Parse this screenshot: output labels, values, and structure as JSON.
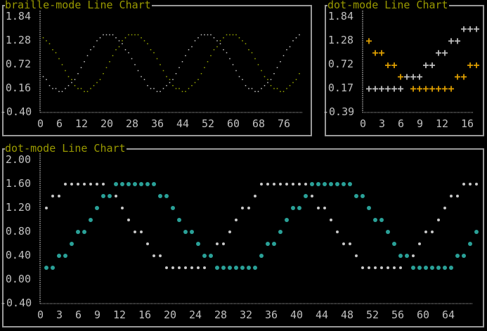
{
  "colors": {
    "title": "#9a9a00",
    "text": "#c0c0c0",
    "border": "#9a9a9a",
    "gray_series": "#c8c8c8",
    "green_series": "#9aaa00",
    "orange_series": "#e0a000",
    "teal_series": "#2aa198"
  },
  "chart_data": [
    {
      "type": "line",
      "title": "braille-mode Line Chart",
      "marker": "braille",
      "ylim": [
        -0.4,
        1.84
      ],
      "xlim": [
        0,
        82
      ],
      "yticks": [
        "1.84",
        "1.28",
        "0.72",
        "0.16",
        "-0.40"
      ],
      "xticks": [
        0,
        6,
        12,
        20,
        28,
        36,
        44,
        52,
        60,
        68,
        76
      ],
      "series": [
        {
          "name": "series-1",
          "color": "#c8c8c8",
          "x_start": 1,
          "values": [
            0.46,
            0.34,
            0.25,
            0.18,
            0.13,
            0.11,
            0.12,
            0.15,
            0.21,
            0.29,
            0.4,
            0.52,
            0.65,
            0.78,
            0.91,
            1.04,
            1.16,
            1.27,
            1.35,
            1.41,
            1.44,
            1.45,
            1.43,
            1.38,
            1.31,
            1.22,
            1.1,
            0.98,
            0.85,
            0.71,
            0.58,
            0.46,
            0.34,
            0.25,
            0.18,
            0.13,
            0.11,
            0.12,
            0.15,
            0.21,
            0.29,
            0.4,
            0.52,
            0.65,
            0.78,
            0.91,
            1.04,
            1.16,
            1.27,
            1.35,
            1.41,
            1.44,
            1.45,
            1.43,
            1.38,
            1.31,
            1.22,
            1.1,
            0.98,
            0.85,
            0.71,
            0.58,
            0.46,
            0.34,
            0.25,
            0.18,
            0.13,
            0.11,
            0.12,
            0.15,
            0.21,
            0.29,
            0.4,
            0.52,
            0.65,
            0.78,
            0.91,
            1.04,
            1.16,
            1.27,
            1.35,
            1.41
          ]
        },
        {
          "name": "series-2",
          "color": "#9aaa00",
          "x_start": 1,
          "values": [
            1.38,
            1.31,
            1.22,
            1.1,
            0.98,
            0.85,
            0.71,
            0.58,
            0.46,
            0.34,
            0.25,
            0.18,
            0.13,
            0.11,
            0.12,
            0.15,
            0.21,
            0.29,
            0.4,
            0.52,
            0.65,
            0.78,
            0.91,
            1.04,
            1.16,
            1.27,
            1.35,
            1.41,
            1.44,
            1.45,
            1.43,
            1.38,
            1.31,
            1.22,
            1.1,
            0.98,
            0.85,
            0.71,
            0.58,
            0.46,
            0.34,
            0.25,
            0.18,
            0.13,
            0.11,
            0.12,
            0.15,
            0.21,
            0.29,
            0.4,
            0.52,
            0.65,
            0.78,
            0.91,
            1.04,
            1.16,
            1.27,
            1.35,
            1.41,
            1.44,
            1.45,
            1.43,
            1.38,
            1.31,
            1.22,
            1.1,
            0.98,
            0.85,
            0.71,
            0.58,
            0.46,
            0.34,
            0.25,
            0.18,
            0.13,
            0.11,
            0.12,
            0.15,
            0.21,
            0.29,
            0.4,
            0.52
          ]
        }
      ]
    },
    {
      "type": "line",
      "title": "dot-mode Line Chart",
      "marker": "+",
      "ylim": [
        -0.39,
        1.84
      ],
      "xlim": [
        0,
        18
      ],
      "yticks": [
        "1.84",
        "1.28",
        "0.72",
        "0.17",
        "-0.39"
      ],
      "xticks": [
        0,
        3,
        6,
        9,
        12,
        16
      ],
      "series": [
        {
          "name": "series-1",
          "color": "#c0c0c0",
          "x_start": 1,
          "values": [
            0.17,
            0.17,
            0.17,
            0.17,
            0.17,
            0.17,
            0.45,
            0.45,
            0.45,
            0.72,
            0.72,
            1.0,
            1.0,
            1.28,
            1.28,
            1.56,
            1.56,
            1.56
          ]
        },
        {
          "name": "series-2",
          "color": "#e0a000",
          "x_start": 1,
          "values": [
            1.28,
            1.0,
            1.0,
            0.72,
            0.72,
            0.45,
            null,
            0.17,
            0.17,
            0.17,
            0.17,
            0.17,
            0.17,
            0.17,
            0.45,
            0.45,
            0.72,
            0.72
          ]
        }
      ]
    },
    {
      "type": "scatter",
      "title": "dot-mode Line Chart",
      "marker": "dot",
      "ylim": [
        -0.4,
        2.0
      ],
      "xlim": [
        0,
        69
      ],
      "yticks": [
        "2.00",
        "1.60",
        "1.20",
        "0.80",
        "0.40",
        "0.00",
        "-0.40"
      ],
      "xticks": [
        0,
        3,
        6,
        9,
        12,
        16,
        20,
        24,
        28,
        32,
        36,
        40,
        44,
        48,
        52,
        56,
        60,
        64
      ],
      "series": [
        {
          "name": "series-1",
          "color": "#c8c8c8",
          "x_start": 1,
          "values": [
            1.2,
            1.4,
            1.4,
            1.6,
            1.6,
            1.6,
            1.6,
            1.6,
            1.6,
            1.6,
            1.4,
            1.4,
            1.2,
            1.0,
            0.8,
            0.8,
            0.6,
            0.4,
            0.4,
            0.2,
            0.2,
            0.2,
            0.2,
            0.2,
            0.2,
            0.2,
            0.4,
            0.6,
            0.6,
            0.8,
            1.0,
            1.2,
            1.2,
            1.4,
            1.6,
            1.6,
            1.6,
            1.6,
            1.6,
            1.6,
            1.6,
            1.6,
            1.4,
            1.2,
            1.2,
            1.0,
            0.8,
            0.6,
            0.6,
            0.4,
            0.2,
            0.2,
            0.2,
            0.2,
            0.2,
            0.2,
            0.2,
            0.4,
            0.4,
            0.6,
            0.8,
            0.8,
            1.0,
            1.2,
            1.4,
            1.4,
            1.6,
            1.6,
            1.6
          ]
        },
        {
          "name": "series-2",
          "color": "#2aa198",
          "x_start": 1,
          "values": [
            0.2,
            0.2,
            0.4,
            0.4,
            0.6,
            0.8,
            0.8,
            1.0,
            1.2,
            1.4,
            1.4,
            1.6,
            1.6,
            1.6,
            1.6,
            1.6,
            1.6,
            1.6,
            1.4,
            1.4,
            1.2,
            1.0,
            0.8,
            0.8,
            0.6,
            0.4,
            0.4,
            0.2,
            0.2,
            0.2,
            0.2,
            0.2,
            0.2,
            0.2,
            0.4,
            0.6,
            0.6,
            0.8,
            1.0,
            1.2,
            1.2,
            1.4,
            1.6,
            1.6,
            1.6,
            1.6,
            1.6,
            1.6,
            1.6,
            1.4,
            1.4,
            1.2,
            1.0,
            1.0,
            0.8,
            0.6,
            0.4,
            0.4,
            0.2,
            0.2,
            0.2,
            0.2,
            0.2,
            0.2,
            0.2,
            0.4,
            0.4,
            0.6,
            0.8
          ]
        }
      ]
    }
  ]
}
